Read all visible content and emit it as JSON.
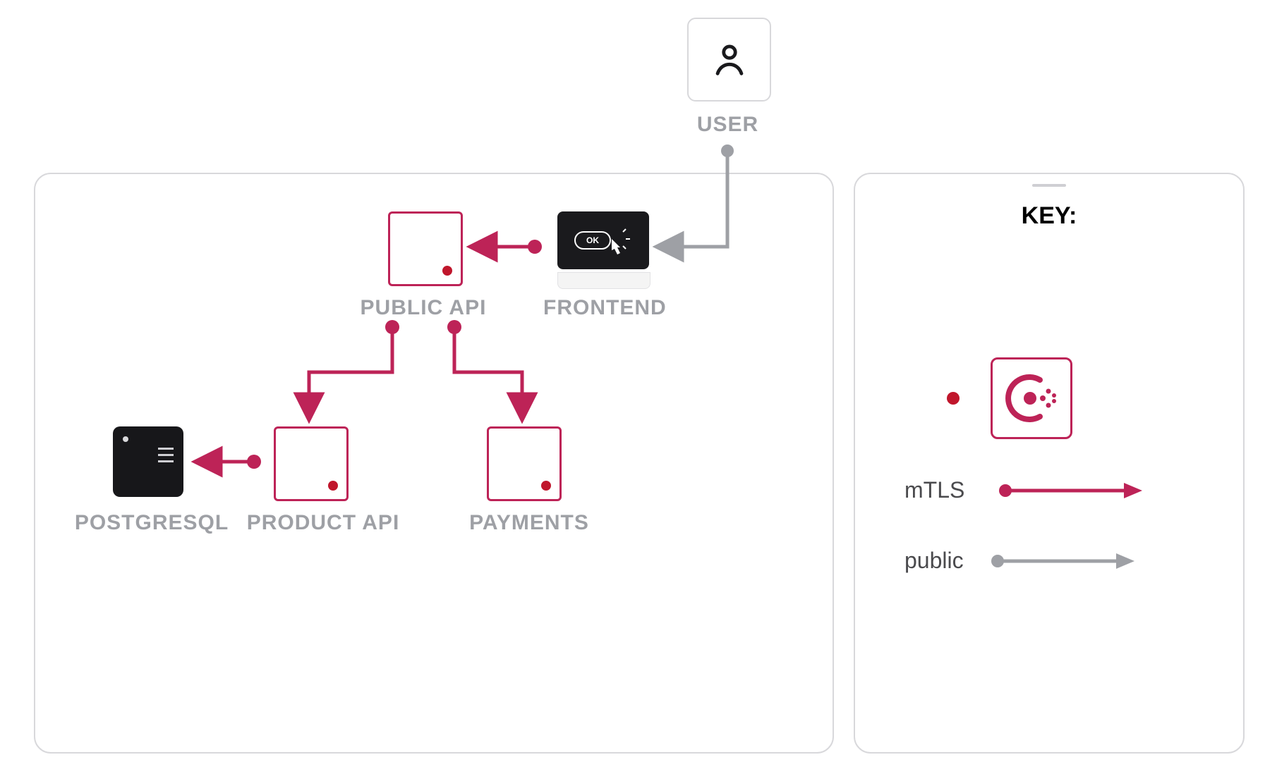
{
  "nodes": {
    "user": {
      "label": "USER"
    },
    "frontend": {
      "label": "FRONTEND",
      "screen_badge": "OK"
    },
    "public_api": {
      "label": "PUBLIC API"
    },
    "product_api": {
      "label": "PRODUCT API"
    },
    "payments": {
      "label": "PAYMENTS"
    },
    "postgresql": {
      "label": "POSTGRESQL"
    }
  },
  "edges": [
    {
      "from": "user",
      "to": "frontend",
      "kind": "public"
    },
    {
      "from": "frontend",
      "to": "public_api",
      "kind": "mtls"
    },
    {
      "from": "public_api",
      "to": "product_api",
      "kind": "mtls"
    },
    {
      "from": "public_api",
      "to": "payments",
      "kind": "mtls"
    },
    {
      "from": "product_api",
      "to": "postgresql",
      "kind": "mtls"
    }
  ],
  "legend": {
    "title": "KEY:",
    "mtls_label": "mTLS",
    "public_label": "public"
  },
  "colors": {
    "mtls": "#bd2357",
    "public": "#9ea0a5",
    "dot": "#c0162c",
    "label": "#9ea0a5",
    "border": "#d8d8db"
  }
}
